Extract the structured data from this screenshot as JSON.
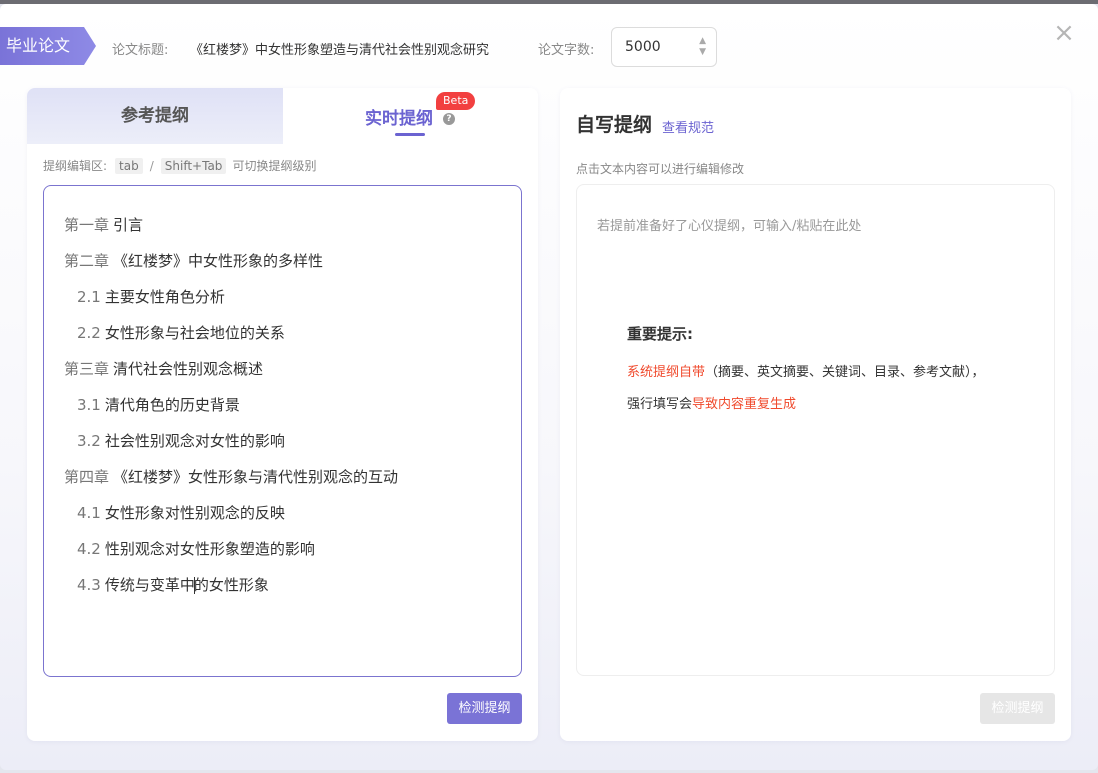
{
  "header": {
    "tag": "毕业论文",
    "title_label": "论文标题:",
    "title_value": "《红楼梦》中女性形象塑造与清代社会性别观念研究",
    "words_label": "论文字数:",
    "words_value": "5000",
    "close_symbol": "×"
  },
  "left": {
    "tab_reference": "参考提纲",
    "tab_live": "实时提纲",
    "beta_badge": "Beta",
    "help_symbol": "?",
    "hint_prefix": "提纲编辑区:",
    "hint_key1": "tab",
    "hint_sep": "/",
    "hint_key2": "Shift+Tab",
    "hint_suffix": "可切换提纲级别",
    "outline": [
      {
        "num": "第一章",
        "text": "引言"
      },
      {
        "num": "第二章",
        "text": "《红楼梦》中女性形象的多样性"
      },
      {
        "num": "2.1",
        "text": "主要女性角色分析"
      },
      {
        "num": "2.2",
        "text": "女性形象与社会地位的关系"
      },
      {
        "num": "第三章",
        "text": "清代社会性别观念概述"
      },
      {
        "num": "3.1",
        "text": "清代角色的历史背景"
      },
      {
        "num": "3.2",
        "text": "社会性别观念对女性的影响"
      },
      {
        "num": "第四章",
        "text": "《红楼梦》女性形象与清代性别观念的互动"
      },
      {
        "num": "4.1",
        "text": "女性形象对性别观念的反映"
      },
      {
        "num": "4.2",
        "text": "性别观念对女性形象塑造的影响"
      },
      {
        "num": "4.3",
        "text_a": "传统与变革中",
        "text_b": "的女性形象"
      }
    ],
    "check_button": "检测提纲"
  },
  "right": {
    "title": "自写提纲",
    "link": "查看规范",
    "hint": "点击文本内容可以进行编辑修改",
    "placeholder": "若提前准备好了心仪提纲，可输入/粘贴在此处",
    "notice_title": "重要提示:",
    "notice_red1": "系统提纲自带",
    "notice_text1": "（摘要、英文摘要、关键词、目录、参考文献），",
    "notice_text2": "强行填写会",
    "notice_red2": "导致内容重复生成",
    "check_button": "检测提纲"
  }
}
